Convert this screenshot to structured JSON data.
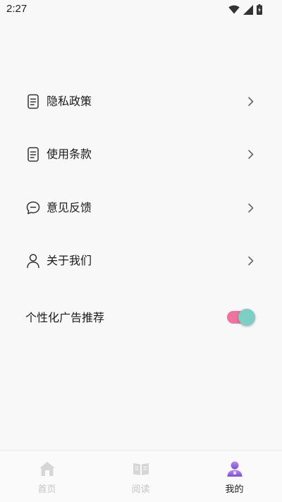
{
  "status_bar": {
    "time": "2:27"
  },
  "menu": {
    "items": [
      {
        "label": "隐私政策",
        "icon": "document-icon"
      },
      {
        "label": "使用条款",
        "icon": "document-icon"
      },
      {
        "label": "意见反馈",
        "icon": "chat-icon"
      },
      {
        "label": "关于我们",
        "icon": "person-icon"
      }
    ],
    "toggle": {
      "label": "个性化广告推荐",
      "on": true
    }
  },
  "bottom_nav": {
    "tabs": [
      {
        "label": "首页",
        "icon": "home-icon",
        "active": false
      },
      {
        "label": "阅读",
        "icon": "book-icon",
        "active": false
      },
      {
        "label": "我的",
        "icon": "profile-icon",
        "active": true
      }
    ]
  },
  "colors": {
    "toggle_track": "#f0739d",
    "toggle_knob": "#7ccfc2",
    "active_icon": "#9b6fe0"
  }
}
